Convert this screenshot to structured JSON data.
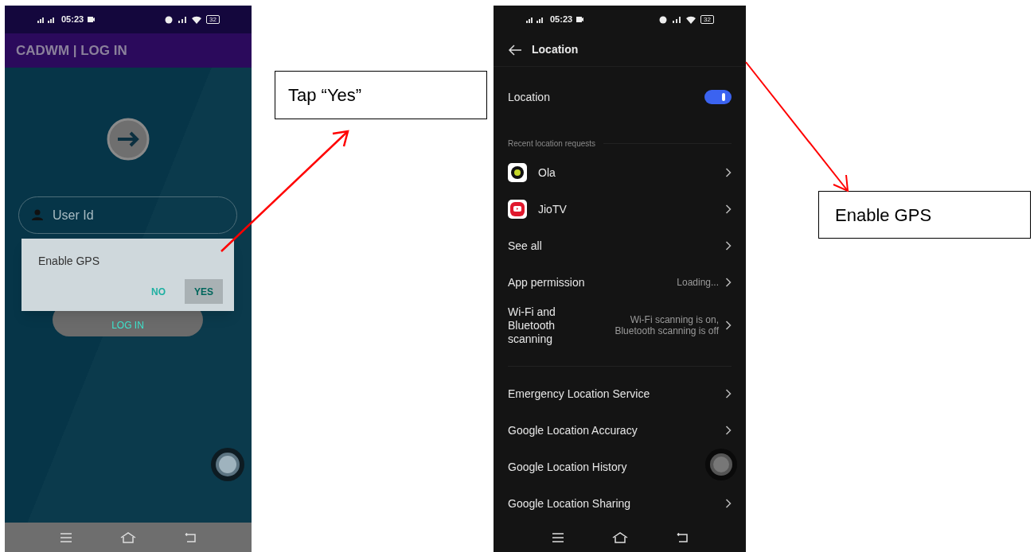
{
  "left_phone": {
    "status_bar": {
      "time": "05:23",
      "battery": "32"
    },
    "app_bar": {
      "title": "CADWM | LOG IN"
    },
    "user_id_field": {
      "placeholder": "User Id"
    },
    "login_button": {
      "label": "LOG IN"
    },
    "dialog": {
      "message": "Enable GPS",
      "buttons": [
        {
          "label": "NO",
          "selected": false
        },
        {
          "label": "YES",
          "selected": true
        }
      ]
    }
  },
  "callouts": [
    {
      "text": "Tap “Yes”"
    },
    {
      "text": "Enable GPS"
    }
  ],
  "right_phone": {
    "status_bar": {
      "time": "05:23",
      "battery": "32"
    },
    "header": {
      "title": "Location"
    },
    "location_toggle": {
      "label": "Location",
      "on": true
    },
    "section_label": "Recent location requests",
    "recent_requests": [
      {
        "label": "Ola"
      },
      {
        "label": "JioTV"
      }
    ],
    "settings": [
      {
        "label": "See all"
      },
      {
        "label": "App permission",
        "value": "Loading..."
      },
      {
        "label": "Wi-Fi and Bluetooth scanning",
        "value": "Wi-Fi scanning is on,\nBluetooth scanning is off"
      }
    ],
    "more_settings": [
      {
        "label": "Emergency Location Service"
      },
      {
        "label": "Google Location Accuracy"
      },
      {
        "label": "Google Location History"
      },
      {
        "label": "Google Location Sharing"
      }
    ]
  }
}
